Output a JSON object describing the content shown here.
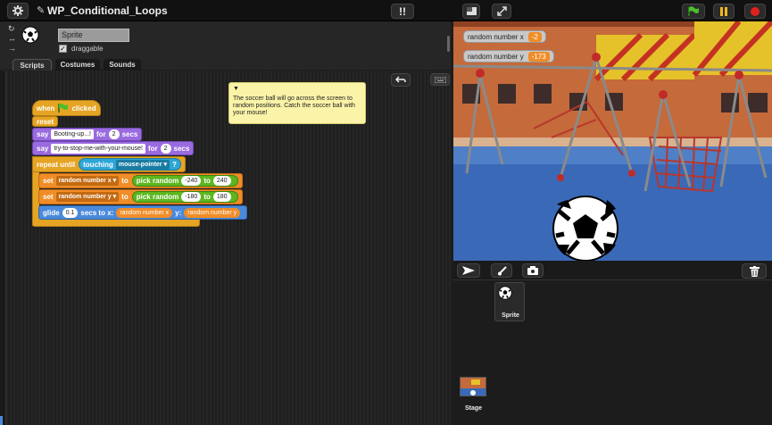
{
  "topbar": {
    "gear_icon": "gear-icon",
    "project_title": "WP_Conditional_Loops",
    "turbo_icon": "turbo-icon",
    "layout_icon": "small-stage-icon",
    "fullscreen_icon": "fullscreen-icon",
    "green_flag_icon": "green-flag-icon",
    "pause_icon": "pause-icon",
    "stop_icon": "stop-icon"
  },
  "sprite_info": {
    "name_value": "Sprite",
    "draggable_label": "draggable",
    "draggable_checked": true,
    "rotation_style_icons": [
      "rotate-icon",
      "left-right-icon",
      "no-rotate-icon"
    ]
  },
  "tabs": [
    {
      "label": "Scripts",
      "active": true
    },
    {
      "label": "Costumes",
      "active": false
    },
    {
      "label": "Sound s",
      "active": false
    }
  ],
  "scripts": {
    "hat": {
      "when": "when",
      "clicked": "clicked"
    },
    "reset": "reset",
    "say1": {
      "say": "say",
      "msg": "Booting-up...!",
      "for": "for",
      "secs_val": "2",
      "secs": "secs"
    },
    "say2": {
      "say": "say",
      "msg": "try-to-stop-me-with-your-mouse!",
      "for": "for",
      "secs_val": "2",
      "secs": "secs"
    },
    "repeat_until": {
      "label": "repeat until",
      "touching": "touching",
      "target": "mouse-pointer",
      "q": "?"
    },
    "setx": {
      "set": "set",
      "var": "random number x",
      "to": "to",
      "pick": "pick random",
      "from": "-240",
      "to2": "to",
      "to_val": "240"
    },
    "sety": {
      "set": "set",
      "var": "random number y",
      "to": "to",
      "pick": "pick random",
      "from": "-180",
      "to2": "to",
      "to_val": "180"
    },
    "glide": {
      "glide": "glide",
      "secs_val": "0.1",
      "secs_to_x": "secs to x:",
      "x_var": "random number x",
      "y": "y:",
      "y_var": "random number y"
    }
  },
  "note": {
    "text": "The soccer ball will go across the screen to random positions. Catch the soccer ball with your mouse!"
  },
  "stage": {
    "monitors": [
      {
        "label": "random number x",
        "value": "-2"
      },
      {
        "label": "random number y",
        "value": "-173"
      }
    ]
  },
  "corral": {
    "tools": [
      "arrow-icon",
      "paintbrush-icon",
      "camera-icon"
    ],
    "trash_icon": "trash-icon",
    "sprites": [
      {
        "name": "Sprite"
      }
    ],
    "stage_label": "Stage"
  },
  "colors": {
    "events": "#e6a424",
    "looks": "#9a6ae0",
    "data": "#f08d28",
    "motion": "#4a8adc",
    "sensing": "#2ea6d6",
    "operator": "#5cb71f"
  }
}
